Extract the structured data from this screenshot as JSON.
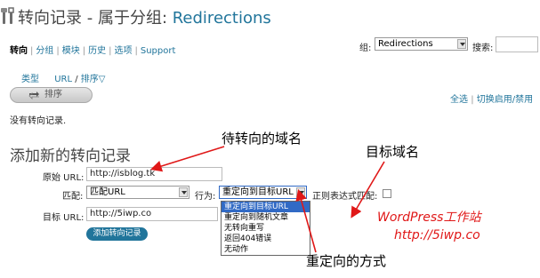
{
  "header": {
    "title_prefix": "转向记录 - 属于分组: ",
    "group_link": "Redirections"
  },
  "subnav": {
    "items": [
      "转向",
      "分组",
      "模块",
      "历史",
      "选项",
      "Support"
    ]
  },
  "filter": {
    "group_label": "组:",
    "group_value": "Redirections",
    "search_label": "搜索:",
    "search_value": ""
  },
  "columns": {
    "type": "类型",
    "url": "URL",
    "slash": "/",
    "sort": "排序▽"
  },
  "actions": {
    "sort_button": "排序",
    "select_all": "全选",
    "sep": "|",
    "toggle": "切换启用/禁用"
  },
  "status": {
    "empty": "没有转向记录."
  },
  "form": {
    "section_title": "添加新的转向记录",
    "source_label": "原始 URL:",
    "source_value": "http://isblog.tk",
    "match_label": "匹配:",
    "match_value": "匹配URL",
    "action_label": "行为:",
    "action_value": "重定向到目标URL",
    "regex_label": "正则表达式匹配:",
    "target_label": "目标 URL:",
    "target_value": "http://5iwp.co",
    "submit": "添加转向记录",
    "action_options": [
      "重定向到目标URL",
      "重定向到随机文章",
      "无转向重写",
      "返回404错误",
      "无动作"
    ]
  },
  "annotations": {
    "source_callout": "待转向的域名",
    "target_callout": "目标域名",
    "method_callout": "重定向的方式",
    "brand_line1": "WordPress工作站",
    "brand_line2": "http://5iwp.co"
  },
  "colors": {
    "link": "#21759b",
    "arrow": "#e01818",
    "selected_option": "#316ac5"
  }
}
